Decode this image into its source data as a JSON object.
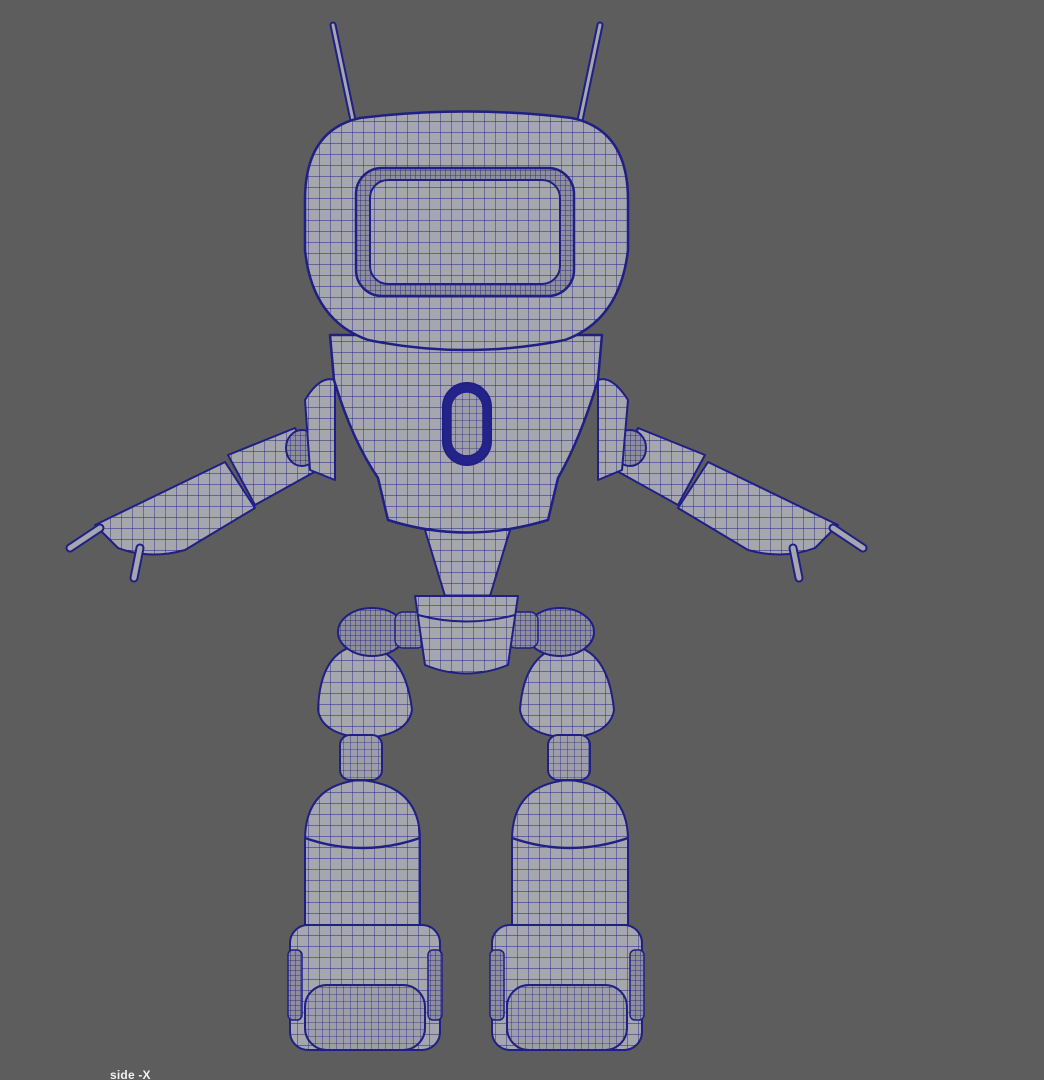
{
  "viewport": {
    "camera_label": "side -X",
    "background_color": "#5d5d5d",
    "wire_color": "#1f1f86",
    "shade_color": "#a4a4ac"
  },
  "model": {
    "parts": [
      "antenna-left",
      "antenna-right",
      "head",
      "screen",
      "torso",
      "chest-button",
      "neck",
      "pelvis",
      "arm-left",
      "arm-right",
      "leg-left",
      "leg-right",
      "foot-left",
      "foot-right"
    ]
  }
}
